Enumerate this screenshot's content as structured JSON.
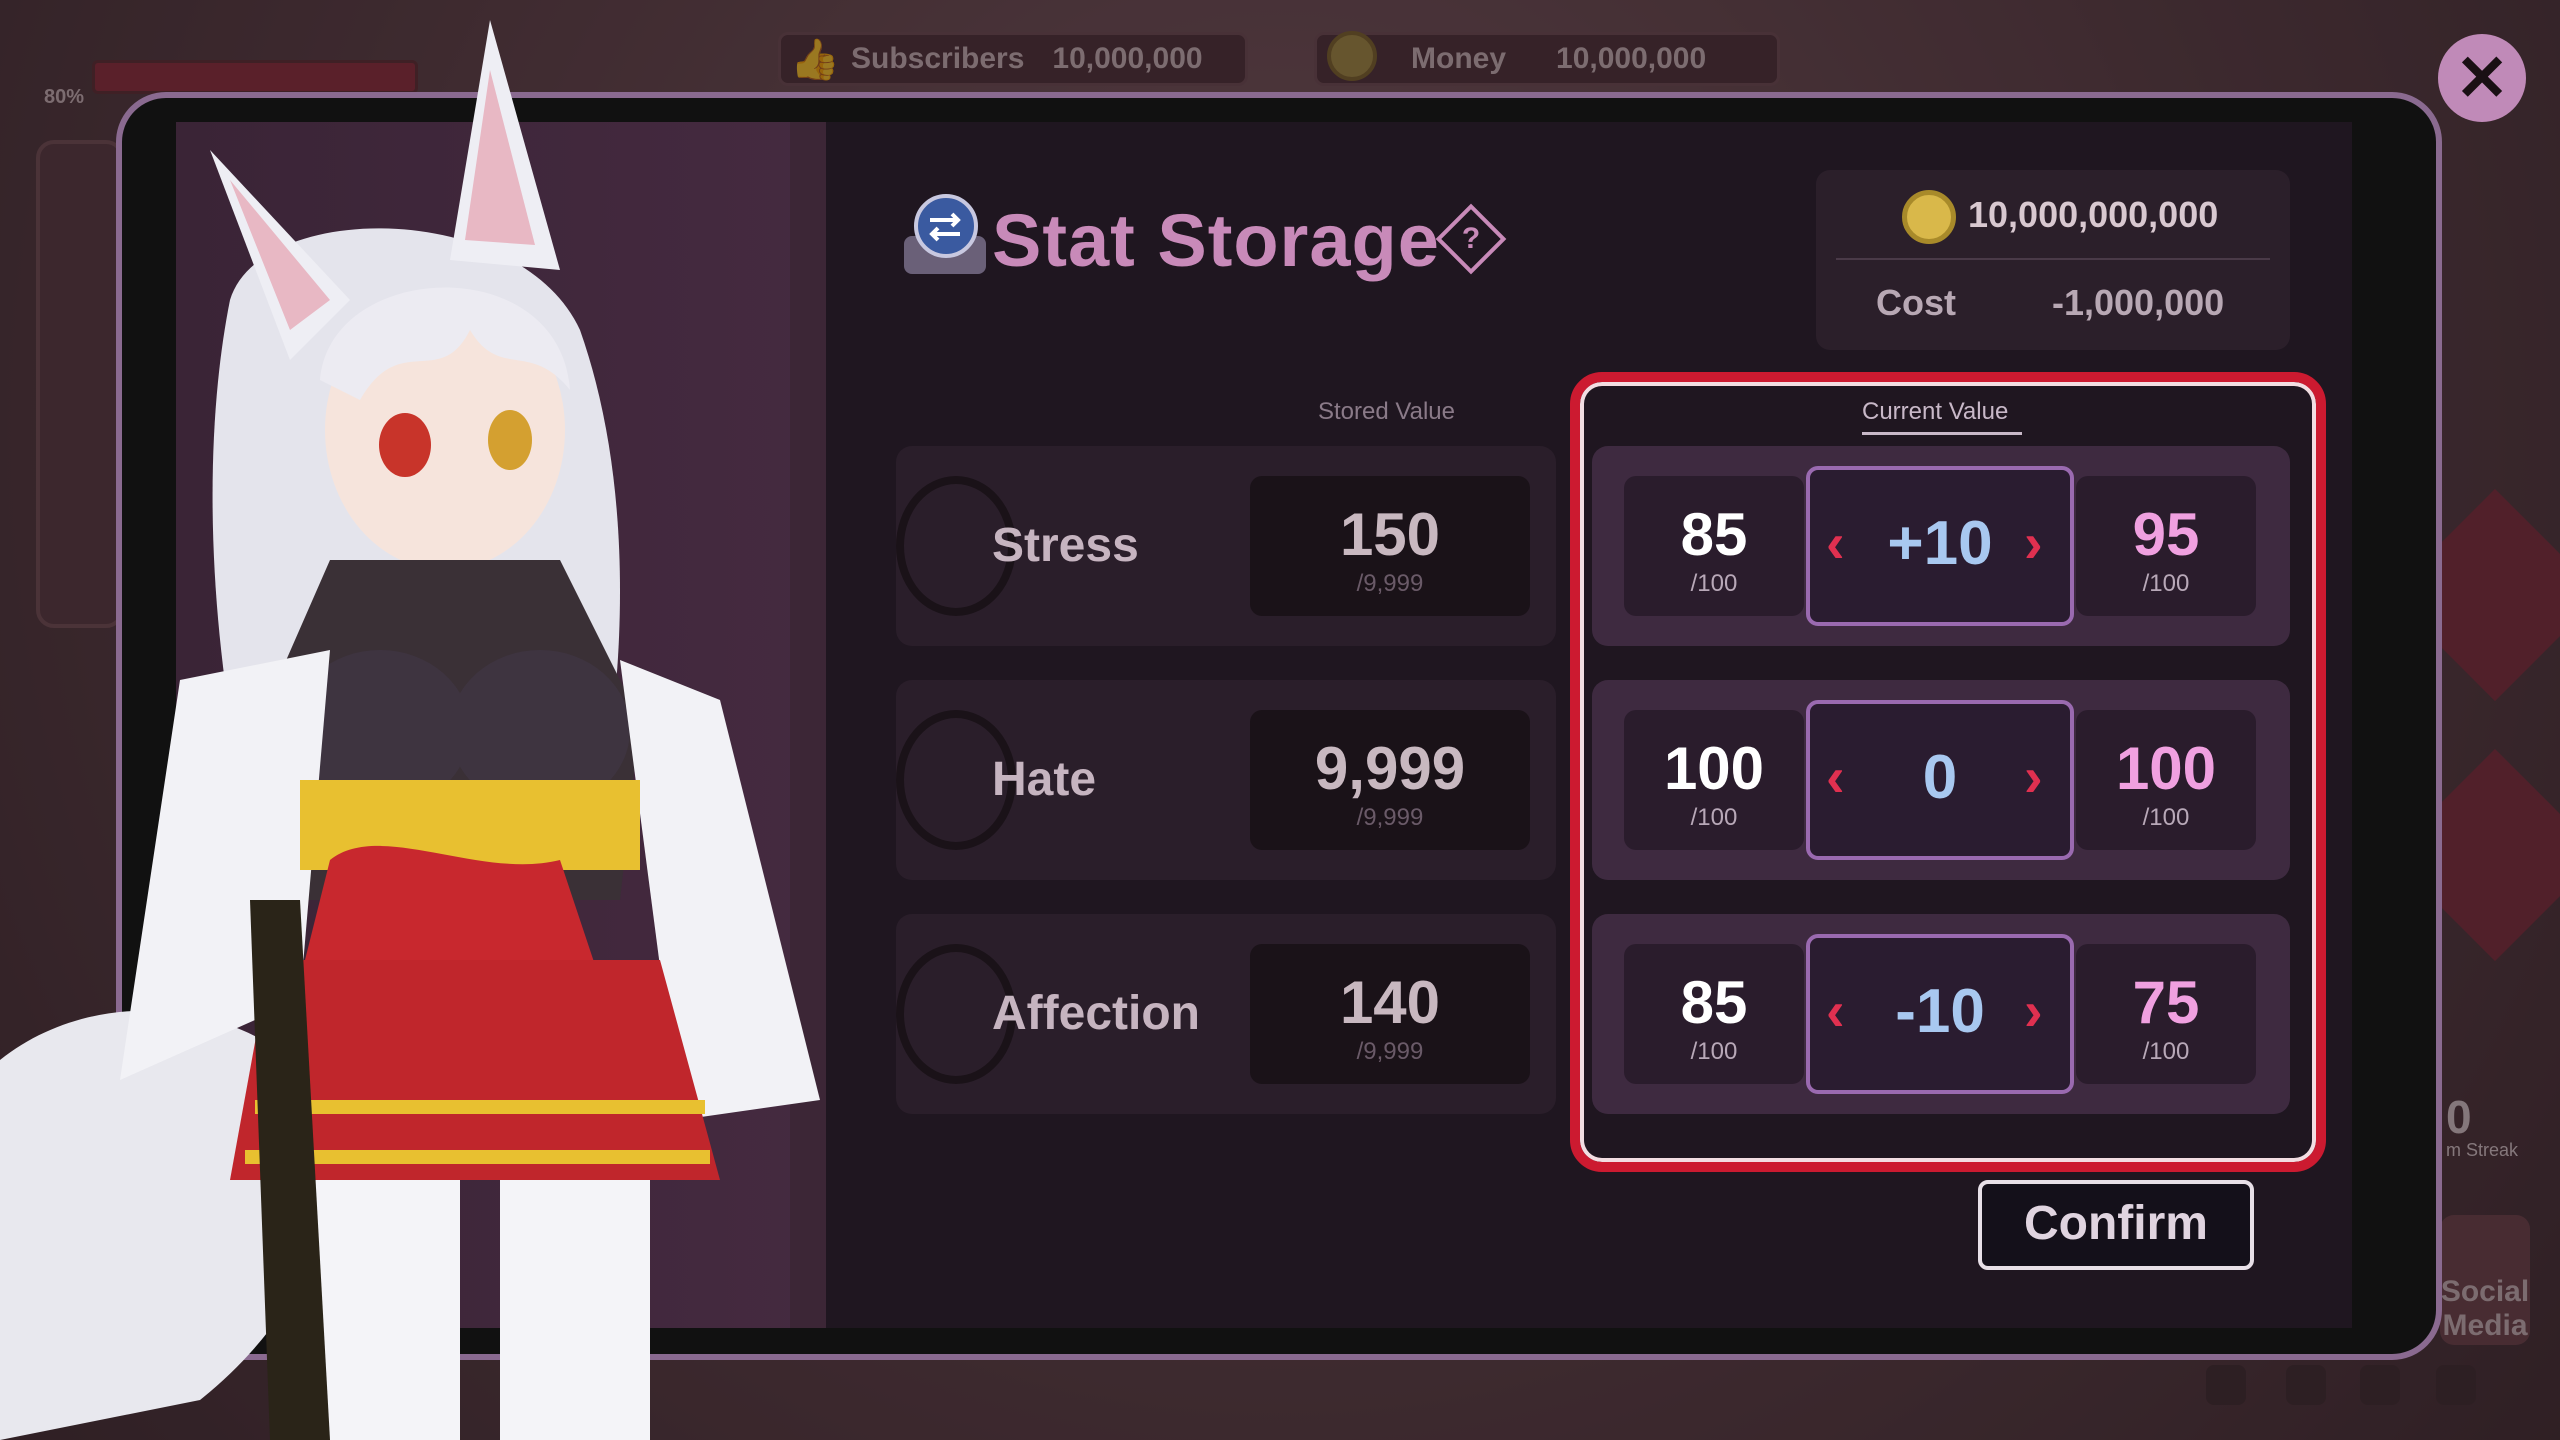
{
  "hud": {
    "subscribers_label": "Subscribers",
    "subscribers_value": "10,000,000",
    "money_label": "Money",
    "money_value": "10,000,000",
    "avatar_percent": "80%"
  },
  "modal": {
    "title": "Stat Storage",
    "help_glyph": "?",
    "balance": "10,000,000,000",
    "cost_label": "Cost",
    "cost_value": "-1,000,000",
    "stored_header": "Stored Value",
    "current_header": "Current Value",
    "confirm_label": "Confirm",
    "close_glyph": "✕"
  },
  "stats": [
    {
      "name": "Stress",
      "stored": "150",
      "stored_max": "/9,999",
      "current": "85",
      "current_max": "/100",
      "delta": "+10",
      "result": "95",
      "result_max": "/100"
    },
    {
      "name": "Hate",
      "stored": "9,999",
      "stored_max": "/9,999",
      "current": "100",
      "current_max": "/100",
      "delta": "0",
      "result": "100",
      "result_max": "/100"
    },
    {
      "name": "Affection",
      "stored": "140",
      "stored_max": "/9,999",
      "current": "85",
      "current_max": "/100",
      "delta": "-10",
      "result": "75",
      "result_max": "/100"
    }
  ],
  "background": {
    "social_label": "Social Media",
    "streak_label": "m Streak",
    "streak_value": "0"
  },
  "colors": {
    "accent": "#c88ab9",
    "highlight": "#cc1a30",
    "delta": "#a8c8f0",
    "result": "#f0a0e0",
    "arrow": "#e03050"
  }
}
